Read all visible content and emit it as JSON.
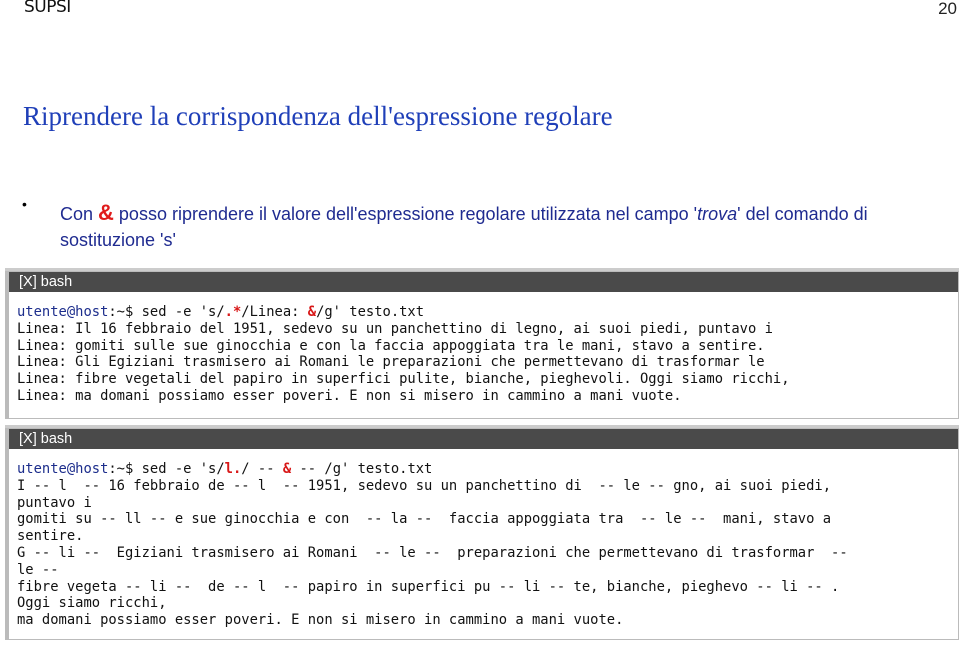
{
  "header": {
    "logo": "SUPSI",
    "page_number": "20"
  },
  "slide": {
    "title": "Riprendere la corrispondenza dell'espressione regolare",
    "bullet": {
      "pre": "Con ",
      "symbol": "&",
      "mid": " posso riprendere il valore dell'espressione regolare utilizzata nel campo '",
      "italic": "trova",
      "post": "' del comando di sostituzione 's'"
    }
  },
  "terminals": [
    {
      "title": "[X] bash",
      "prompt_user": "utente@host",
      "prompt_rest": ":~$ sed -e 's/",
      "cmd_hl1": ".*",
      "cmd_mid": "/Linea: ",
      "cmd_hl2": "&",
      "cmd_end": "/g' testo.txt",
      "output": [
        "Linea: Il 16 febbraio del 1951, sedevo su un panchettino di legno, ai suoi piedi, puntavo i",
        "Linea: gomiti sulle sue ginocchia e con la faccia appoggiata tra le mani, stavo a sentire.",
        "Linea: Gli Egiziani trasmisero ai Romani le preparazioni che permettevano di trasformar le",
        "Linea: fibre vegetali del papiro in superfici pulite, bianche, pieghevoli. Oggi siamo ricchi,",
        "Linea: ma domani possiamo esser poveri. E non si misero in cammino a mani vuote."
      ]
    },
    {
      "title": "[X] bash",
      "prompt_user": "utente@host",
      "prompt_rest": ":~$ sed -e 's/",
      "cmd_hl1": "l.",
      "cmd_mid": "/ -- ",
      "cmd_hl2": "&",
      "cmd_end": " -- /g' testo.txt",
      "output": [
        "I -- l  -- 16 febbraio de -- l  -- 1951, sedevo su un panchettino di  -- le -- gno, ai suoi piedi,",
        "puntavo i",
        "gomiti su -- ll -- e sue ginocchia e con  -- la --  faccia appoggiata tra  -- le --  mani, stavo a",
        "sentire.",
        "G -- li --  Egiziani trasmisero ai Romani  -- le --  preparazioni che permettevano di trasformar  --",
        "le --",
        "fibre vegeta -- li --  de -- l  -- papiro in superfici pu -- li -- te, bianche, pieghevo -- li -- .",
        "Oggi siamo ricchi,",
        "ma domani possiamo esser poveri. E non si misero in cammino a mani vuote."
      ]
    }
  ]
}
